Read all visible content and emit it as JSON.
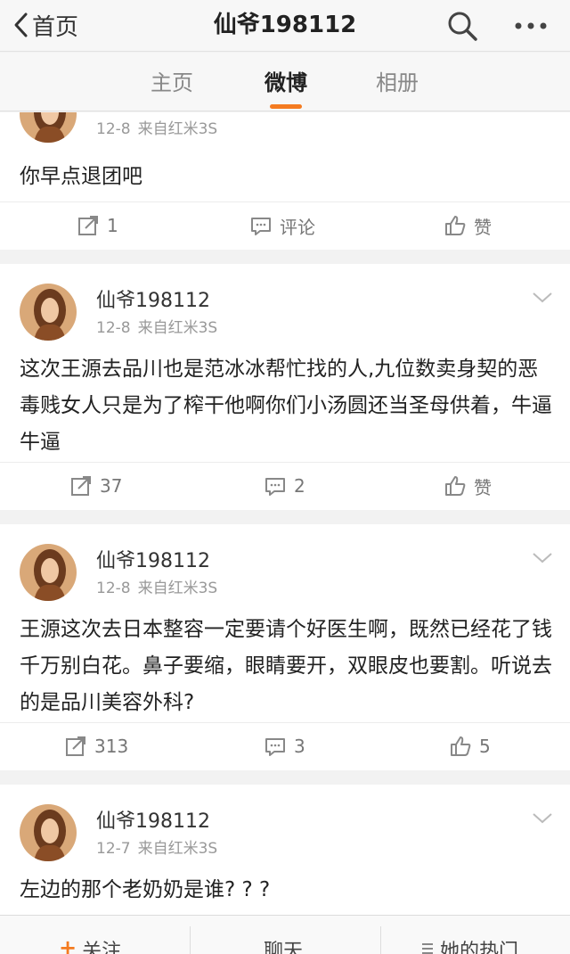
{
  "header": {
    "back_label": "首页",
    "title": "仙爷198112"
  },
  "tabs": [
    {
      "label": "主页"
    },
    {
      "label": "微博"
    },
    {
      "label": "相册"
    }
  ],
  "accent_color": "#f47b20",
  "posts": [
    {
      "username": "",
      "date": "12-8",
      "source": "来自红米3S",
      "text": "你早点退团吧",
      "repost": "1",
      "comment": "评论",
      "like": "赞"
    },
    {
      "username": "仙爷198112",
      "date": "12-8",
      "source": "来自红米3S",
      "text": "这次王源去品川也是范冰冰帮忙找的人,九位数卖身契的恶毒贱女人只是为了榨干他啊你们小汤圆还当圣母供着，牛逼牛逼",
      "repost": "37",
      "comment": "2",
      "like": "赞"
    },
    {
      "username": "仙爷198112",
      "date": "12-8",
      "source": "来自红米3S",
      "text": "王源这次去日本整容一定要请个好医生啊，既然已经花了钱千万别白花。鼻子要缩，眼睛要开，双眼皮也要割。听说去的是品川美容外科?",
      "repost": "313",
      "comment": "3",
      "like": "5"
    },
    {
      "username": "仙爷198112",
      "date": "12-7",
      "source": "来自红米3S",
      "text": "左边的那个老奶奶是谁? ? ?"
    }
  ],
  "bottombar": {
    "follow": "关注",
    "follow_plus": "+",
    "chat": "聊天",
    "hot": "她的热门"
  }
}
